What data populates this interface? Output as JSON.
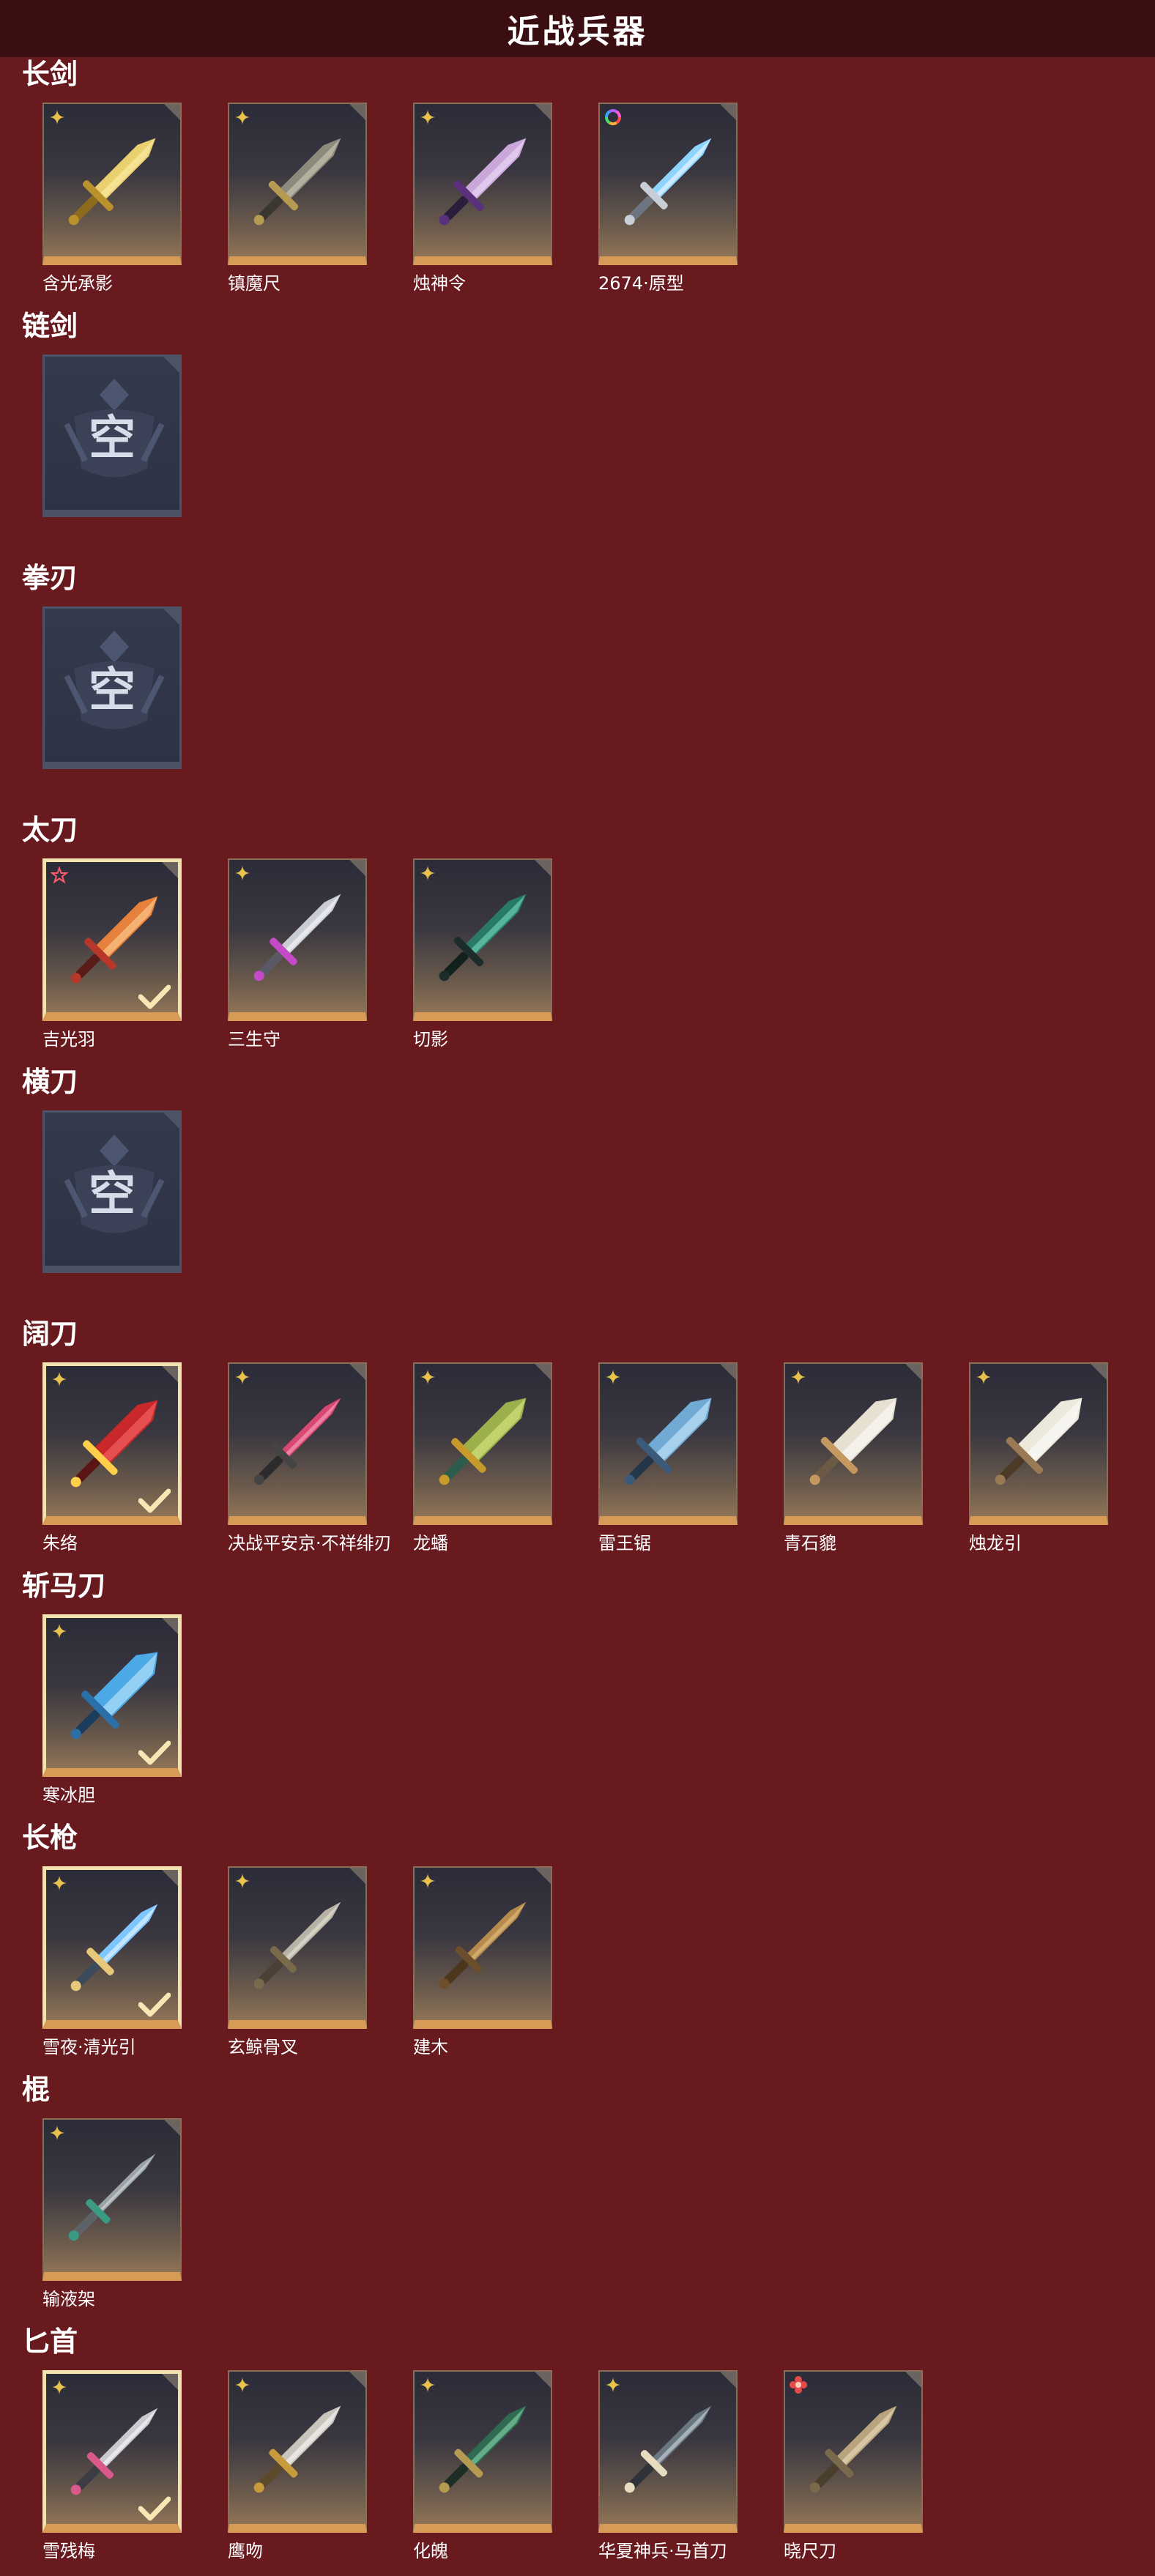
{
  "page_title": "近战兵器",
  "colors": {
    "background": "#681a1f",
    "header": "#3b0f12",
    "card_accent": "#d79a57",
    "equipped_border": "#f2e2ad",
    "empty_card": "#343a4d"
  },
  "sections": [
    {
      "title": "长剑",
      "items": [
        {
          "name": "含光承影",
          "rank_icon": "sparkle-icon",
          "equipped": false,
          "weapon": "gold-sword"
        },
        {
          "name": "镇魔尺",
          "rank_icon": "sparkle-icon",
          "equipped": false,
          "weapon": "dark-sword"
        },
        {
          "name": "烛神令",
          "rank_icon": "sparkle-icon",
          "equipped": false,
          "weapon": "purple-sword"
        },
        {
          "name": "2674·原型",
          "rank_icon": "rainbow-ring-icon",
          "equipped": false,
          "weapon": "light-sword"
        }
      ]
    },
    {
      "title": "链剑",
      "items": [
        {
          "name": "",
          "empty": true,
          "empty_text": "空"
        }
      ]
    },
    {
      "title": "拳刃",
      "items": [
        {
          "name": "",
          "empty": true,
          "empty_text": "空"
        }
      ]
    },
    {
      "title": "太刀",
      "items": [
        {
          "name": "吉光羽",
          "rank_icon": "red-star-icon",
          "equipped": true,
          "weapon": "flame-katana"
        },
        {
          "name": "三生守",
          "rank_icon": "sparkle-icon",
          "equipped": false,
          "weapon": "silver-katana"
        },
        {
          "name": "切影",
          "rank_icon": "sparkle-icon",
          "equipped": false,
          "weapon": "jade-katana"
        }
      ]
    },
    {
      "title": "横刀",
      "items": [
        {
          "name": "",
          "empty": true,
          "empty_text": "空"
        }
      ]
    },
    {
      "title": "阔刀",
      "items": [
        {
          "name": "朱络",
          "rank_icon": "sparkle-icon",
          "equipped": true,
          "weapon": "red-broadsword"
        },
        {
          "name": "决战平安京·不祥绯刃",
          "rank_icon": "sparkle-icon",
          "equipped": false,
          "weapon": "pink-blade"
        },
        {
          "name": "龙蟠",
          "rank_icon": "sparkle-icon",
          "equipped": false,
          "weapon": "green-gold-blade"
        },
        {
          "name": "雷王锯",
          "rank_icon": "sparkle-icon",
          "equipped": false,
          "weapon": "blue-saw"
        },
        {
          "name": "青石貔",
          "rank_icon": "sparkle-icon",
          "equipped": false,
          "weapon": "white-beast-blade"
        },
        {
          "name": "烛龙引",
          "rank_icon": "sparkle-icon",
          "equipped": false,
          "weapon": "white-dragon-blade"
        }
      ]
    },
    {
      "title": "斩马刀",
      "items": [
        {
          "name": "寒冰胆",
          "rank_icon": "sparkle-icon",
          "equipped": true,
          "weapon": "ice-blade"
        }
      ]
    },
    {
      "title": "长枪",
      "items": [
        {
          "name": "雪夜·清光引",
          "rank_icon": "sparkle-icon",
          "equipped": true,
          "weapon": "ice-spear"
        },
        {
          "name": "玄鲸骨叉",
          "rank_icon": "sparkle-icon",
          "equipped": false,
          "weapon": "trident"
        },
        {
          "name": "建木",
          "rank_icon": "sparkle-icon",
          "equipped": false,
          "weapon": "wood-spear"
        }
      ]
    },
    {
      "title": "棍",
      "items": [
        {
          "name": "输液架",
          "rank_icon": "sparkle-icon",
          "equipped": false,
          "weapon": "iv-stand"
        }
      ]
    },
    {
      "title": "匕首",
      "items": [
        {
          "name": "雪残梅",
          "rank_icon": "sparkle-icon",
          "equipped": true,
          "weapon": "plum-dagger"
        },
        {
          "name": "鹰吻",
          "rank_icon": "sparkle-icon",
          "equipped": false,
          "weapon": "curved-dagger"
        },
        {
          "name": "化魄",
          "rank_icon": "sparkle-icon",
          "equipped": false,
          "weapon": "green-dagger"
        },
        {
          "name": "华夏神兵·马首刀",
          "rank_icon": "sparkle-icon",
          "equipped": false,
          "weapon": "horse-dagger"
        },
        {
          "name": "晓尺刀",
          "rank_icon": "red-flower-icon",
          "equipped": false,
          "weapon": "bronze-dagger"
        }
      ]
    }
  ]
}
